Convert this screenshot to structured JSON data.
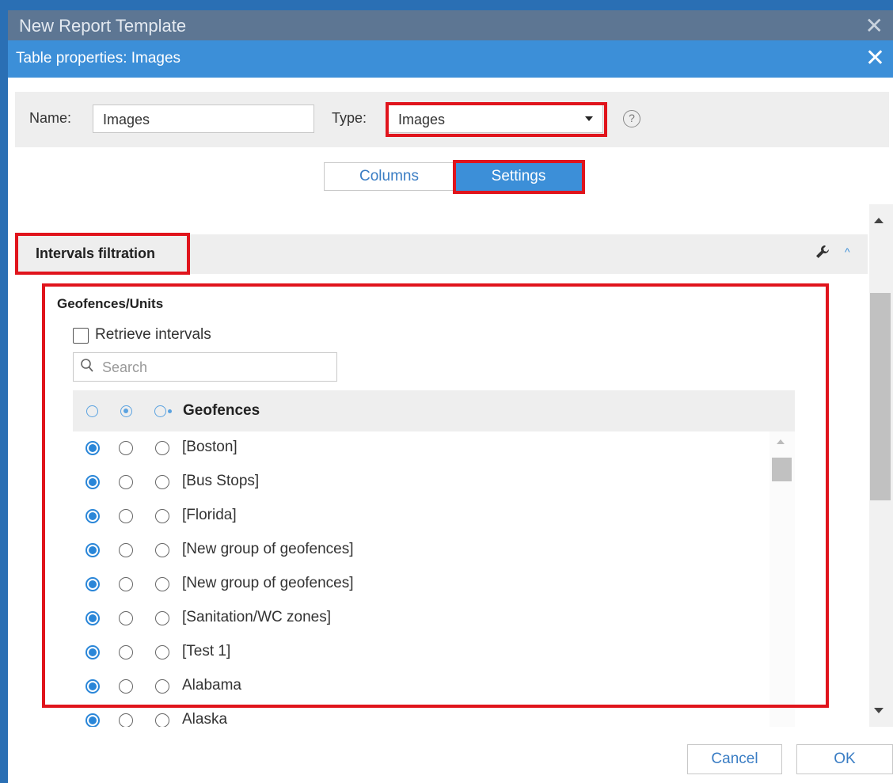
{
  "outer": {
    "title": "New Report Template",
    "close": "✕"
  },
  "dialog": {
    "title": "Table properties: Images",
    "close": "✕"
  },
  "form": {
    "name_label": "Name:",
    "name_value": "Images",
    "type_label": "Type:",
    "type_value": "Images",
    "help": "?"
  },
  "tabs": {
    "columns": "Columns",
    "settings": "Settings",
    "active": "Settings"
  },
  "section": {
    "title": "Intervals filtration",
    "tool_icon": "wrench-icon",
    "collapse": "^"
  },
  "filter": {
    "group_title": "Geofences/Units",
    "retrieve_label": "Retrieve intervals",
    "retrieve_checked": false,
    "search_placeholder": "Search",
    "list_title": "Geofences",
    "items": [
      {
        "label": "[Boston]",
        "selected": 0
      },
      {
        "label": "[Bus Stops]",
        "selected": 0
      },
      {
        "label": "[Florida]",
        "selected": 0
      },
      {
        "label": "[New group of geofences]",
        "selected": 0
      },
      {
        "label": "[New group of geofences]",
        "selected": 0
      },
      {
        "label": "[Sanitation/WC zones]",
        "selected": 0
      },
      {
        "label": "[Test 1]",
        "selected": 0
      },
      {
        "label": "Alabama",
        "selected": 0
      },
      {
        "label": "Alaska",
        "selected": 0
      }
    ]
  },
  "buttons": {
    "cancel": "Cancel",
    "ok": "OK"
  },
  "colors": {
    "accent": "#3c8fd8",
    "highlight": "#e0141c",
    "title_bar": "#5d7693"
  }
}
